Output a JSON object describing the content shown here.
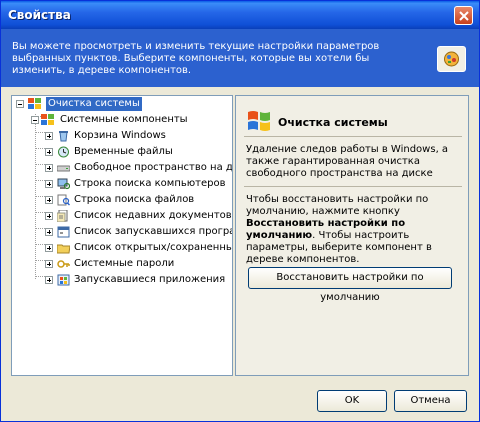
{
  "window": {
    "title": "Свойства"
  },
  "header": {
    "description": "Вы можете просмотреть и изменить текущие настройки параметров выбранных пунктов. Выберите компоненты, которые вы хотели бы изменить, в дереве компонентов."
  },
  "tree": {
    "root": {
      "label": "Очистка системы",
      "selected": true
    },
    "group": {
      "label": "Системные компоненты"
    },
    "items": [
      {
        "label": "Корзина Windows",
        "icon": "recycle-bin-icon"
      },
      {
        "label": "Временные файлы",
        "icon": "temp-files-icon"
      },
      {
        "label": "Свободное пространство на диск",
        "icon": "disk-icon"
      },
      {
        "label": "Строка поиска компьютеров",
        "icon": "search-computers-icon"
      },
      {
        "label": "Строка поиска файлов",
        "icon": "search-files-icon"
      },
      {
        "label": "Список недавних документов",
        "icon": "recent-docs-icon"
      },
      {
        "label": "Список запускавшихся програми",
        "icon": "run-list-icon"
      },
      {
        "label": "Список открытых/сохраненных с",
        "icon": "open-saved-icon"
      },
      {
        "label": "Системные пароли",
        "icon": "passwords-icon"
      },
      {
        "label": "Запускавшиеся приложения",
        "icon": "apps-icon"
      }
    ]
  },
  "panel": {
    "title": "Очистка системы",
    "description": "Удаление следов работы в Windows, а также гарантированная очистка свободного пространства на диске",
    "hint_part1": "Чтобы восстановить настройки по умолчанию, нажмите кнопку ",
    "hint_bold": "Восстановить настройки по умолчанию",
    "hint_part2": ". Чтобы настроить параметры, выберите компонент в дереве компонентов.",
    "restore_button": "Восстановить настройки по умолчанию"
  },
  "buttons": {
    "ok": "OK",
    "cancel": "Отмена"
  },
  "colors": {
    "titlebar": "#0a5ce6",
    "header": "#2c61cf",
    "selection": "#316ac5",
    "dialog": "#ece9d8"
  }
}
